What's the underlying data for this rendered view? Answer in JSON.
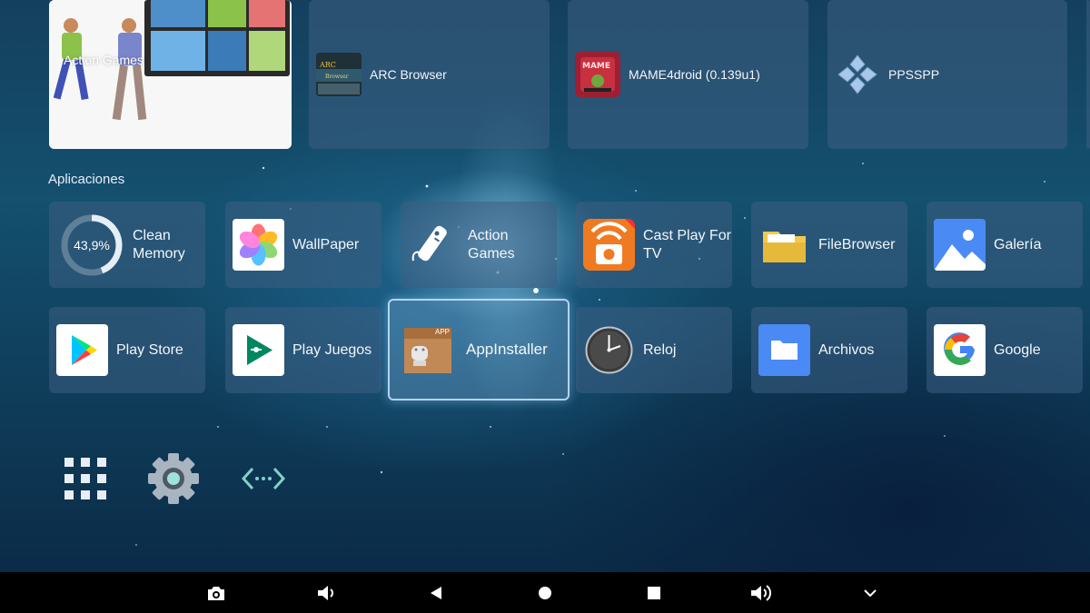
{
  "featured_row": [
    {
      "label": "Action Games"
    },
    {
      "label": "ARC Browser",
      "icon": "arc-browser-icon"
    },
    {
      "label": "MAME4droid (0.139u1)",
      "icon": "mame4droid-icon"
    },
    {
      "label": "PPSSPP",
      "icon": "ppsspp-icon"
    }
  ],
  "section": {
    "title": "Aplicaciones"
  },
  "apps_row1": [
    {
      "label": "Clean Memory",
      "icon": "memory-gauge-icon",
      "gauge_text": "43,9%",
      "gauge_value": 0.439
    },
    {
      "label": "WallPaper",
      "icon": "wallpaper-flower-icon"
    },
    {
      "label": "Action Games",
      "icon": "wii-remote-icon"
    },
    {
      "label": "Cast Play For TV",
      "icon": "cast-play-icon"
    },
    {
      "label": "FileBrowser",
      "icon": "folder-icon"
    },
    {
      "label": "Galería",
      "icon": "gallery-icon"
    }
  ],
  "apps_row2": [
    {
      "label": "Play Store",
      "icon": "play-store-icon"
    },
    {
      "label": "Play Juegos",
      "icon": "play-games-icon"
    },
    {
      "label": "AppInstaller",
      "icon": "app-installer-icon",
      "badge": "APP"
    },
    {
      "label": "Reloj",
      "icon": "clock-icon"
    },
    {
      "label": "Archivos",
      "icon": "files-icon"
    },
    {
      "label": "Google",
      "icon": "google-icon"
    }
  ],
  "bottom_buttons": [
    "all-apps-grid-icon",
    "settings-gear-icon",
    "network-arrows-icon"
  ],
  "navbar": [
    "camera-icon",
    "volume-down-icon",
    "back-icon",
    "home-icon",
    "recents-icon",
    "volume-up-icon",
    "chevron-down-icon"
  ],
  "colors": {
    "tile_bg": "#3c5f82",
    "focus_border": "#c8e6ff",
    "navbar_bg": "#000000"
  }
}
